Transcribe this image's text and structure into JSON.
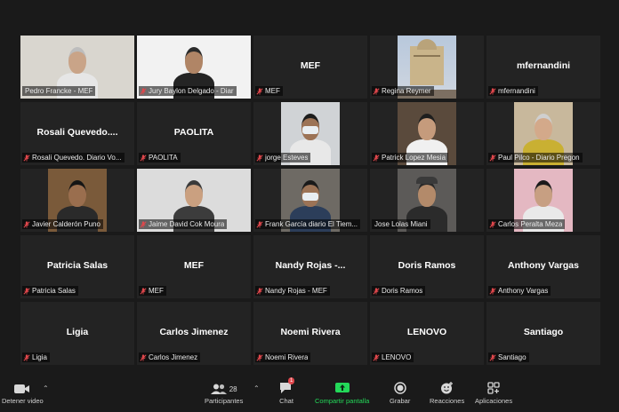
{
  "participants": [
    {
      "name": "Pedro Francke - MEF",
      "display": "",
      "label": "Pedro Francke - MEF",
      "muted": false,
      "video": true,
      "active": true,
      "bg": "#d9d6cf",
      "skin": "#c9a488",
      "hair": "#bdbdbd",
      "shirt": "#e6e6e6"
    },
    {
      "name": "Jury Baylon Delgado - Diar",
      "display": "",
      "label": "Jury Baylon Delgado - Diar",
      "muted": true,
      "video": true,
      "bg": "#f2f2f2",
      "skin": "#b08566",
      "hair": "#2b2b2b",
      "shirt": "#242424"
    },
    {
      "name": "MEF",
      "display": "MEF",
      "label": "MEF",
      "muted": true,
      "video": false
    },
    {
      "name": "Regina Reymer",
      "display": "",
      "label": "Regina Reymer",
      "muted": true,
      "video": true,
      "bg": "#a9b6c9",
      "photo": "building"
    },
    {
      "name": "mfernandini",
      "display": "mfernandini",
      "label": "mfernandini",
      "muted": true,
      "video": false
    },
    {
      "name": "Rosali Quevedo",
      "display": "Rosali  Quevedo....",
      "label": "Rosali Quevedo. Diario Vo...",
      "muted": true,
      "video": false
    },
    {
      "name": "PAOLITA",
      "display": "PAOLITA",
      "label": "PAOLITA",
      "muted": true,
      "video": false
    },
    {
      "name": "jorge Esteves",
      "display": "",
      "label": "jorge Esteves",
      "muted": true,
      "video": true,
      "bg": "#d0d3d6",
      "skin": "#9c7356",
      "hair": "#1c1c1c",
      "shirt": "#e8e8e8",
      "mask": true
    },
    {
      "name": "Patrick Lopez Mesia",
      "display": "",
      "label": "Patrick Lopez Mesia",
      "muted": true,
      "video": true,
      "bg": "#5a4a3c",
      "skin": "#c59b7c",
      "hair": "#1e1e1e",
      "shirt": "#f0f0f0"
    },
    {
      "name": "Paul Pilco - Diario Pregon",
      "display": "",
      "label": "Paul Pilco - Diario Pregon",
      "muted": true,
      "video": true,
      "bg": "#c8b89c",
      "skin": "#d3a98a",
      "hair": "#cfcfcf",
      "shirt": "#c9b032"
    },
    {
      "name": "Javier Calderon Puno",
      "display": "",
      "label": "Javier Calderón Puno",
      "muted": true,
      "video": true,
      "bg": "#7a5a3a",
      "skin": "#9a6e4e",
      "hair": "#151515",
      "shirt": "#2a2a2a"
    },
    {
      "name": "Jaime David Cok Moura",
      "display": "",
      "label": "Jaime David Cok Moura",
      "muted": true,
      "video": true,
      "bg": "#dcdcdc",
      "skin": "#caa080",
      "hair": "#3a3a3a",
      "shirt": "#3c3c3c"
    },
    {
      "name": "Frank Garcia diario El Tiem",
      "display": "",
      "label": "Frank García diario El Tiem...",
      "muted": true,
      "video": true,
      "bg": "#6e6a64",
      "skin": "#9c7356",
      "hair": "#1a1a1a",
      "shirt": "#2c3e5a",
      "mask": true
    },
    {
      "name": "Jose Lolas Miani",
      "display": "",
      "label": "Jose Lolas Miani",
      "muted": false,
      "video": true,
      "bg": "#5c5a58",
      "skin": "#b38a6a",
      "hair": "#2a2a2a",
      "shirt": "#2b2b2b",
      "cap": true
    },
    {
      "name": "Carlos Peralta Meza",
      "display": "",
      "label": "Carlos Peralta Meza",
      "muted": true,
      "video": true,
      "bg": "#e4b8c2",
      "skin": "#c79f82",
      "hair": "#1a1a1a",
      "shirt": "#e9e9e9"
    },
    {
      "name": "Patricia Salas",
      "display": "Patricia Salas",
      "label": "Patricia Salas",
      "muted": true,
      "video": false
    },
    {
      "name": "MEF",
      "display": "MEF",
      "label": "MEF",
      "muted": true,
      "video": false
    },
    {
      "name": "Nandy Rojas - MEF",
      "display": "Nandy  Rojas  -...",
      "label": "Nandy Rojas - MEF",
      "muted": true,
      "video": false
    },
    {
      "name": "Doris Ramos",
      "display": "Doris Ramos",
      "label": "Doris Ramos",
      "muted": true,
      "video": false
    },
    {
      "name": "Anthony Vargas",
      "display": "Anthony Vargas",
      "label": "Anthony Vargas",
      "muted": true,
      "video": false
    },
    {
      "name": "Ligia",
      "display": "Ligia",
      "label": "Ligia",
      "muted": true,
      "video": false
    },
    {
      "name": "Carlos Jimenez",
      "display": "Carlos Jimenez",
      "label": "Carlos Jimenez",
      "muted": true,
      "video": false
    },
    {
      "name": "Noemi Rivera",
      "display": "Noemi Rivera",
      "label": "Noemi Rivera",
      "muted": true,
      "video": false
    },
    {
      "name": "LENOVO",
      "display": "LENOVO",
      "label": "LENOVO",
      "muted": true,
      "video": false
    },
    {
      "name": "Santiago",
      "display": "Santiago",
      "label": "Santiago",
      "muted": true,
      "video": false
    }
  ],
  "toolbar": {
    "video_label": "Detener video",
    "participants_label": "Participantes",
    "participants_count": "28",
    "chat_label": "Chat",
    "chat_badge": "1",
    "share_label": "Compartir pantalla",
    "record_label": "Grabar",
    "reactions_label": "Reacciones",
    "apps_label": "Aplicaciones"
  },
  "colors": {
    "muted_icon": "#e0474c",
    "share_green": "#23d959",
    "chat_badge": "#e0474c",
    "active_speaker": "#c9e04a"
  },
  "icons": {
    "mic_muted": "mic-muted-icon",
    "video": "video-camera-icon",
    "participants": "participants-icon",
    "chat": "chat-icon",
    "share": "share-screen-icon",
    "record": "record-icon",
    "reactions": "reactions-icon",
    "apps": "apps-icon"
  }
}
